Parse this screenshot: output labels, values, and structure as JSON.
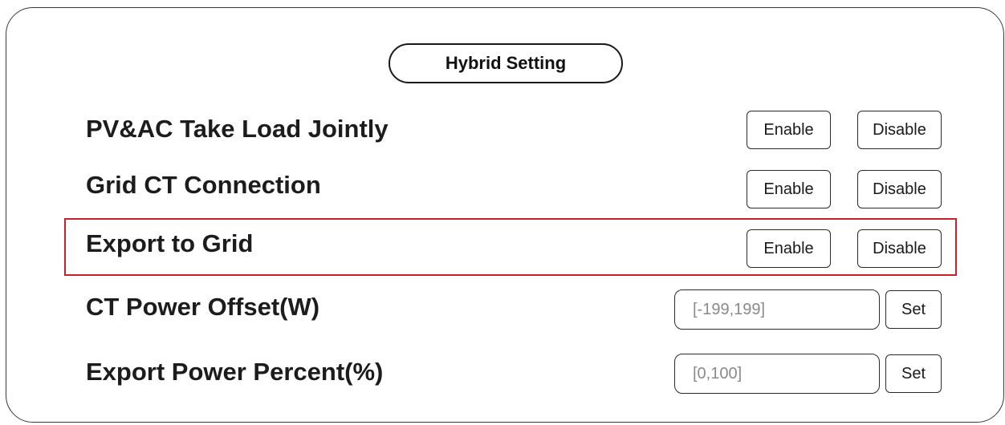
{
  "header": {
    "title": "Hybrid Setting"
  },
  "rows": [
    {
      "label": "PV&AC Take Load Jointly",
      "enable_label": "Enable",
      "disable_label": "Disable"
    },
    {
      "label": "Grid CT Connection",
      "enable_label": "Enable",
      "disable_label": "Disable"
    },
    {
      "label": "Export to Grid",
      "enable_label": "Enable",
      "disable_label": "Disable"
    },
    {
      "label": "CT Power Offset(W)",
      "placeholder": "[-199,199]",
      "set_label": "Set"
    },
    {
      "label": "Export Power Percent(%)",
      "placeholder": "[0,100]",
      "set_label": "Set"
    }
  ],
  "colors": {
    "highlight": "#c8202a",
    "border": "#2a2a2a",
    "placeholder_text": "#8a8a8a"
  }
}
